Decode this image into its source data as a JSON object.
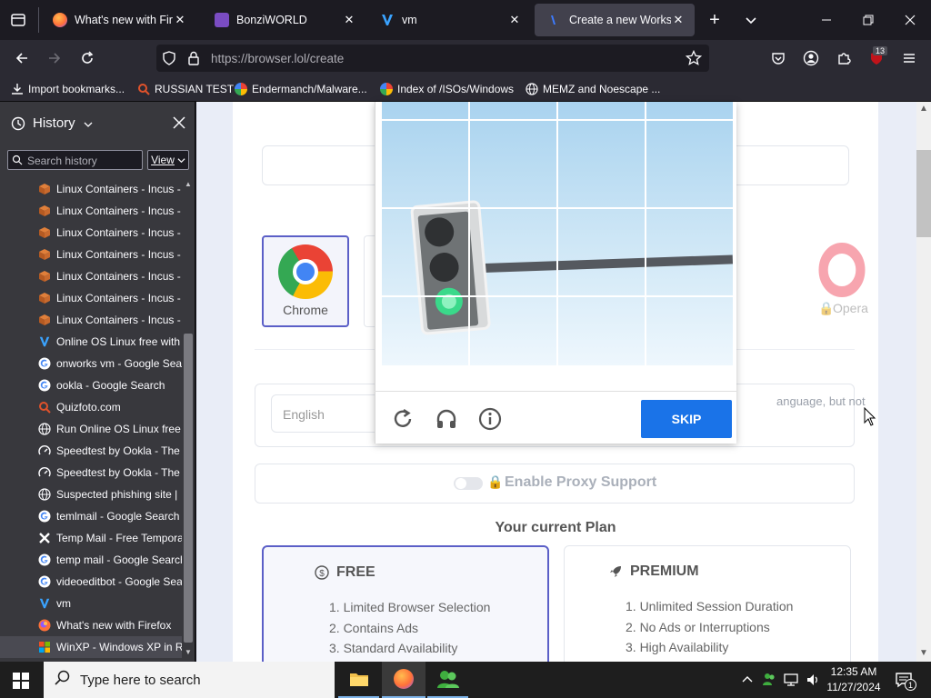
{
  "tabs": [
    {
      "title": "What's new with Firefox",
      "active": false
    },
    {
      "title": "BonziWORLD",
      "active": false
    },
    {
      "title": "vm",
      "active": false
    },
    {
      "title": "Create a new Workspace",
      "active": true
    }
  ],
  "address": {
    "url": "https://browser.lol/create"
  },
  "extensions_badge": "13",
  "bookmarks": [
    "Import bookmarks...",
    "RUSSIAN TEST",
    "Endermanch/Malware...",
    "Index of /ISOs/Windows",
    "MEMZ and Noescape ..."
  ],
  "sidebar": {
    "title": "History",
    "search_placeholder": "Search history",
    "view_label": "View",
    "items": [
      {
        "label": "Linux Containers - Incus -",
        "icon": "box-icon"
      },
      {
        "label": "Linux Containers - Incus -",
        "icon": "box-icon"
      },
      {
        "label": "Linux Containers - Incus -",
        "icon": "box-icon"
      },
      {
        "label": "Linux Containers - Incus -",
        "icon": "box-icon"
      },
      {
        "label": "Linux Containers - Incus -",
        "icon": "box-icon"
      },
      {
        "label": "Linux Containers - Incus -",
        "icon": "box-icon"
      },
      {
        "label": "Linux Containers - Incus -",
        "icon": "box-icon"
      },
      {
        "label": "Online OS Linux free with",
        "icon": "v-logo-icon"
      },
      {
        "label": "onworks vm - Google Sear",
        "icon": "google-icon"
      },
      {
        "label": "ookla - Google Search",
        "icon": "google-icon"
      },
      {
        "label": "Quizfoto.com",
        "icon": "search-glass-icon"
      },
      {
        "label": "Run Online OS Linux free",
        "icon": "globe-icon"
      },
      {
        "label": "Speedtest by Ookla - The",
        "icon": "gauge-icon"
      },
      {
        "label": "Speedtest by Ookla - The",
        "icon": "gauge-icon"
      },
      {
        "label": "Suspected phishing site |",
        "icon": "globe-icon"
      },
      {
        "label": "temlmail - Google Search",
        "icon": "google-icon"
      },
      {
        "label": "Temp Mail - Free Tempora",
        "icon": "x-logo-icon"
      },
      {
        "label": "temp mail - Google Search",
        "icon": "google-icon"
      },
      {
        "label": "videoeditbot - Google Sea",
        "icon": "google-icon"
      },
      {
        "label": "vm",
        "icon": "v-logo-icon"
      },
      {
        "label": "What's new with Firefox",
        "icon": "firefox-icon"
      },
      {
        "label": "WinXP - Windows XP in R",
        "icon": "winxp-icon"
      }
    ]
  },
  "page": {
    "browsers": [
      {
        "name": "Chrome",
        "selected": true
      },
      {
        "name": "Opera",
        "locked": true
      }
    ],
    "language_placeholder": "English",
    "language_note": "anguage, but not",
    "proxy_label": "Enable Proxy Support",
    "plan_heading": "Your current Plan",
    "plans": [
      {
        "name": "FREE",
        "features": [
          "1. Limited Browser Selection",
          "2. Contains Ads",
          "3. Standard Availability"
        ]
      },
      {
        "name": "PREMIUM",
        "features": [
          "1. Unlimited Session Duration",
          "2. No Ads or Interruptions",
          "3. High Availability"
        ]
      }
    ]
  },
  "captcha": {
    "skip_label": "SKIP"
  },
  "taskbar": {
    "search_placeholder": "Type here to search",
    "time": "12:35 AM",
    "date": "11/27/2024",
    "notification_count": "1"
  },
  "colors": {
    "accent_blue": "#1a73e8",
    "plan_border": "#5b5fc7",
    "tab_active": "#42414d"
  }
}
